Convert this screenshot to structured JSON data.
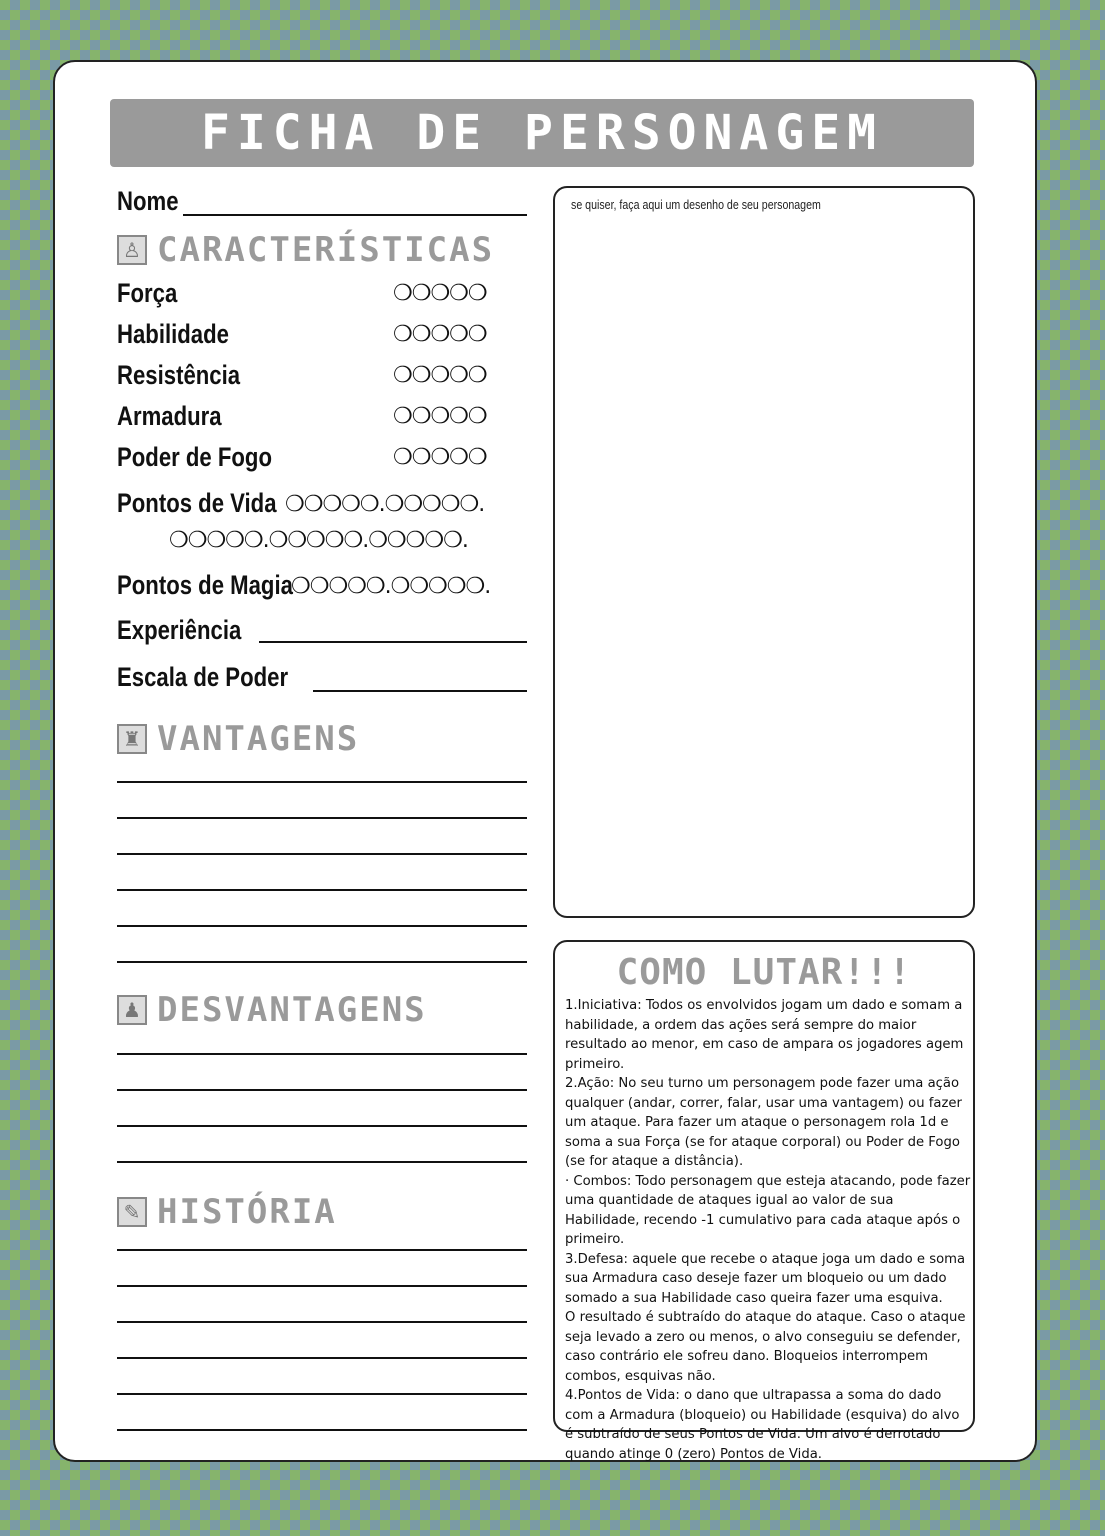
{
  "title": "FICHA DE PERSONAGEM",
  "name_label": "Nome",
  "sections": {
    "characteristics": {
      "title": "Características",
      "icon": "person-stats-icon"
    },
    "advantages": {
      "title": "Vantagens",
      "icon": "muscle-icon"
    },
    "disadvantages": {
      "title": "Desvantagens",
      "icon": "weak-person-icon"
    },
    "history": {
      "title": "História",
      "icon": "scroll-icon"
    }
  },
  "attributes": [
    {
      "label": "Força",
      "dots": "❍❍❍❍❍"
    },
    {
      "label": "Habilidade",
      "dots": "❍❍❍❍❍"
    },
    {
      "label": "Resistência",
      "dots": "❍❍❍❍❍"
    },
    {
      "label": "Armadura",
      "dots": "❍❍❍❍❍"
    },
    {
      "label": "Poder de Fogo",
      "dots": "❍❍❍❍❍"
    }
  ],
  "hit_points": {
    "label": "Pontos de Vida",
    "line1": "❍❍❍❍❍.❍❍❍❍❍.",
    "line2": "❍❍❍❍❍.❍❍❍❍❍.❍❍❍❍❍."
  },
  "magic_points": {
    "label": "Pontos de Magia",
    "dots": "❍❍❍❍❍.❍❍❍❍❍."
  },
  "experience_label": "Experiência",
  "power_scale_label": "Escala de Poder",
  "drawing_hint": "se quiser, faça aqui um desenho de seu personagem",
  "combat": {
    "title": "Como Lutar!!!",
    "rules": [
      "1.Iniciativa: Todos os envolvidos jogam um dado e somam a habilidade, a ordem das ações será sempre do maior resultado ao menor, em caso de ampara os jogadores agem primeiro.",
      "2.Ação: No seu turno um personagem pode fazer uma ação qualquer (andar, correr, falar, usar uma vantagem) ou fazer um ataque. Para fazer um ataque o personagem rola 1d e soma a sua Força (se for ataque corporal) ou Poder de Fogo (se for ataque a distância).",
      "· Combos: Todo personagem que esteja atacando, pode fazer uma quantidade de ataques igual ao valor de sua Habilidade, recendo -1 cumulativo para cada ataque após o primeiro.",
      "3.Defesa: aquele que recebe o ataque joga um dado e soma sua Armadura caso deseje fazer um bloqueio ou um dado somado a sua Habilidade caso queira fazer uma esquiva.",
      "O resultado é subtraído do ataque do ataque. Caso o ataque seja levado a zero ou menos, o alvo conseguiu se defender, caso contrário ele sofreu dano. Bloqueios interrompem combos, esquivas não.",
      "4.Pontos de Vida: o dano que ultrapassa a soma do dado com a Armadura (bloqueio) ou Habilidade (esquiva) do alvo é subtraído de seus Pontos de Vida. Um alvo é derrotado quando atinge 0 (zero) Pontos de Vida."
    ]
  }
}
